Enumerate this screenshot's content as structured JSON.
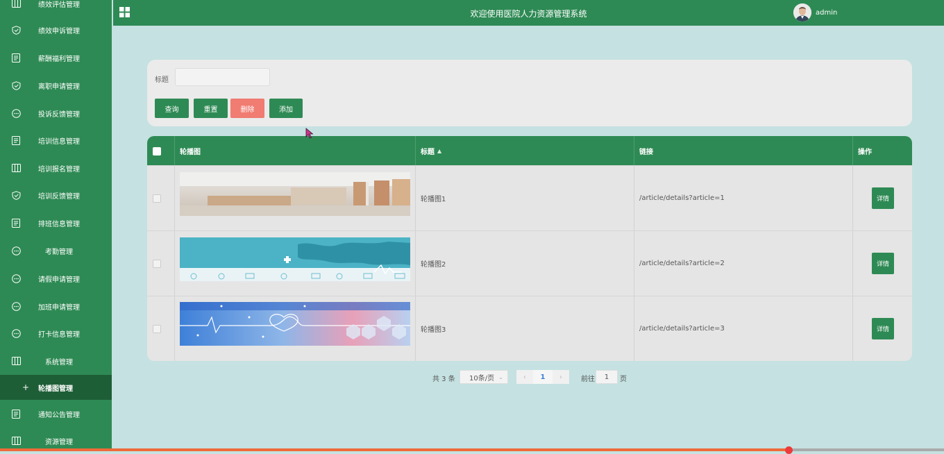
{
  "sidebar": {
    "items": [
      {
        "label": "绩效评估管理",
        "icon": "columns-icon"
      },
      {
        "label": "绩效申诉管理",
        "icon": "shield-check-icon"
      },
      {
        "label": "薪酬福利管理",
        "icon": "document-icon"
      },
      {
        "label": "离职申请管理",
        "icon": "shield-check-icon"
      },
      {
        "label": "投诉反馈管理",
        "icon": "chat-icon"
      },
      {
        "label": "培训信息管理",
        "icon": "document-icon"
      },
      {
        "label": "培训报名管理",
        "icon": "columns-icon"
      },
      {
        "label": "培训反馈管理",
        "icon": "shield-check-icon"
      },
      {
        "label": "排班信息管理",
        "icon": "document-icon"
      },
      {
        "label": "考勤管理",
        "icon": "chat-icon"
      },
      {
        "label": "请假申请管理",
        "icon": "chat-icon"
      },
      {
        "label": "加班申请管理",
        "icon": "chat-icon"
      },
      {
        "label": "打卡信息管理",
        "icon": "chat-icon"
      },
      {
        "label": "系统管理",
        "icon": "columns-icon"
      },
      {
        "label": "轮播图管理",
        "icon": "plus-icon"
      },
      {
        "label": "通知公告管理",
        "icon": "document-icon"
      },
      {
        "label": "资源管理",
        "icon": "columns-icon"
      }
    ]
  },
  "header": {
    "title": "欢迎使用医院人力资源管理系统",
    "username": "admin"
  },
  "search": {
    "label": "标题",
    "value": "",
    "buttons": {
      "query": "查询",
      "reset": "重置",
      "delete": "删除",
      "add": "添加"
    }
  },
  "table": {
    "columns": {
      "image": "轮播图",
      "title": "标题",
      "link": "链接",
      "actions": "操作"
    },
    "rows": [
      {
        "title": "轮播图1",
        "link": "/article/details?article=1",
        "action": "详情"
      },
      {
        "title": "轮播图2",
        "link": "/article/details?article=2",
        "action": "详情"
      },
      {
        "title": "轮播图3",
        "link": "/article/details?article=3",
        "action": "详情"
      }
    ]
  },
  "pagination": {
    "total": "共 3 条",
    "page_size": "10条/页",
    "current_page": "1",
    "goto_label": "前往",
    "goto_value": "1",
    "page_suffix": "页"
  },
  "colors": {
    "primary": "#2e8a54",
    "danger": "#f07c72",
    "background": "#c5e1e1"
  }
}
